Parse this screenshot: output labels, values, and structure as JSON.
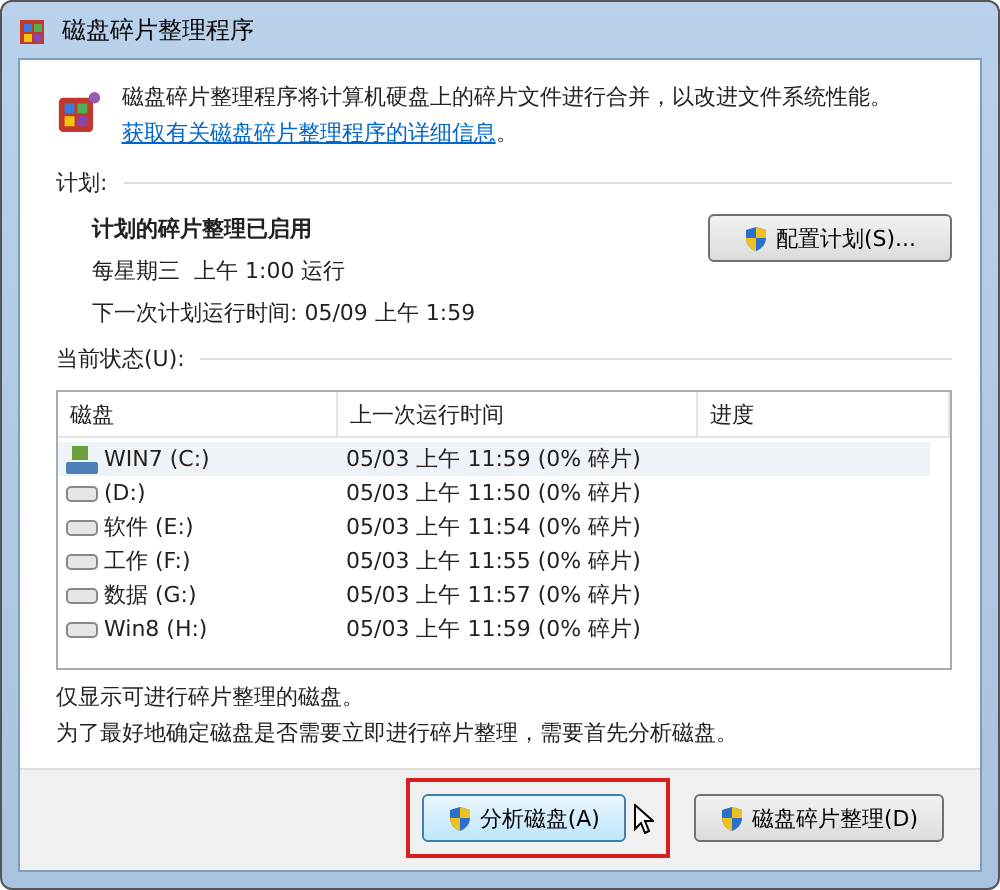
{
  "window": {
    "title": "磁盘碎片整理程序"
  },
  "intro": {
    "text": "磁盘碎片整理程序将计算机硬盘上的碎片文件进行合并，以改进文件系统性能。",
    "link": "获取有关磁盘碎片整理程序的详细信息",
    "suffix": "。"
  },
  "schedule": {
    "heading": "计划:",
    "status": "计划的碎片整理已启用",
    "frequency": "每星期三  上午 1:00 运行",
    "next_run": "下一次计划运行时间: 05/09 上午 1:59",
    "button": "配置计划(S)..."
  },
  "current_status": {
    "heading": "当前状态(U):"
  },
  "table": {
    "columns": [
      "磁盘",
      "上一次运行时间",
      "进度"
    ],
    "rows": [
      {
        "kind": "system",
        "disk": "WIN7 (C:)",
        "last_run": "05/03 上午 11:59 (0% 碎片)",
        "selected": true
      },
      {
        "kind": "drive",
        "disk": "(D:)",
        "last_run": "05/03 上午 11:50 (0% 碎片)",
        "selected": false
      },
      {
        "kind": "drive",
        "disk": "软件 (E:)",
        "last_run": "05/03 上午 11:54 (0% 碎片)",
        "selected": false
      },
      {
        "kind": "drive",
        "disk": "工作 (F:)",
        "last_run": "05/03 上午 11:55 (0% 碎片)",
        "selected": false
      },
      {
        "kind": "drive",
        "disk": "数据 (G:)",
        "last_run": "05/03 上午 11:57 (0% 碎片)",
        "selected": false
      },
      {
        "kind": "drive",
        "disk": "Win8 (H:)",
        "last_run": "05/03 上午 11:59 (0% 碎片)",
        "selected": false
      }
    ]
  },
  "notes": [
    "仅显示可进行碎片整理的磁盘。",
    "为了最好地确定磁盘是否需要立即进行碎片整理，需要首先分析磁盘。"
  ],
  "buttons": [
    {
      "label": "分析磁盘(A)",
      "highlighted": true
    },
    {
      "label": "磁盘碎片整理(D)",
      "highlighted": false
    }
  ]
}
